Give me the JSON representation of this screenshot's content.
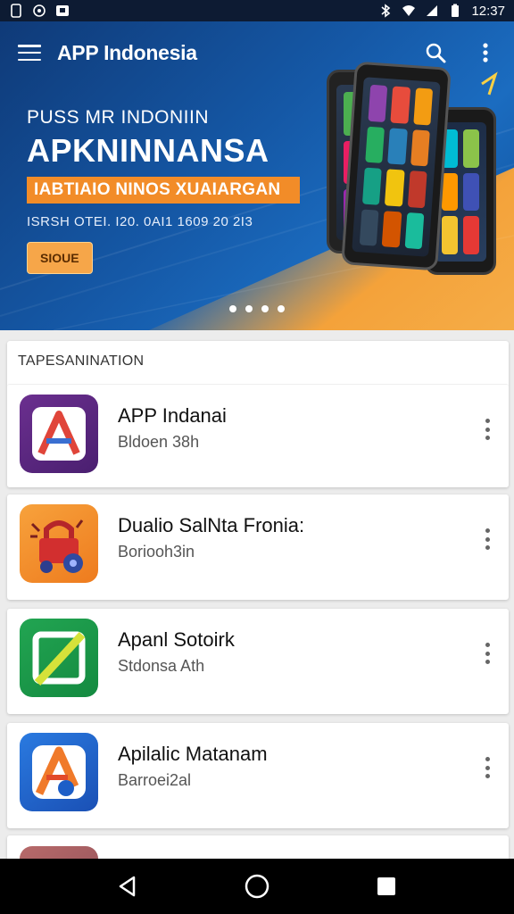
{
  "status_bar": {
    "time": "12:37"
  },
  "app_bar": {
    "title": "APP Indonesia"
  },
  "hero": {
    "kicker": "PUSS MR INDONIIN",
    "headline": "APKNINNANSA",
    "band": "IABTIAIO NINOS XUAIARGAN",
    "meta": "ISRSH OTEI. I20. 0AI1 1609 20 2I3",
    "button": "SIOUE",
    "dots": 4
  },
  "section": {
    "title": "TAPESANINATION"
  },
  "apps": [
    {
      "name": "APP Indanai",
      "sub": "Bldoen 38h",
      "icon": "letter-a-purple-icon",
      "color": "#5b2a86"
    },
    {
      "name": "Dualio SalNta Fronia:",
      "sub": "Boriooh3in",
      "icon": "lock-truck-orange-icon",
      "color": "#f08a24"
    },
    {
      "name": "Apanl Sotoirk",
      "sub": "Stdonsa Ath",
      "icon": "green-slash-icon",
      "color": "#1f9a4a"
    },
    {
      "name": "Apilalic Matanam",
      "sub": "Barroei2al",
      "icon": "letter-a-blue-icon",
      "color": "#1d5ec7"
    }
  ],
  "colors": {
    "accent_orange": "#f28c28",
    "hero_blue": "#1558a6",
    "status_bar": "#0d1b33"
  }
}
